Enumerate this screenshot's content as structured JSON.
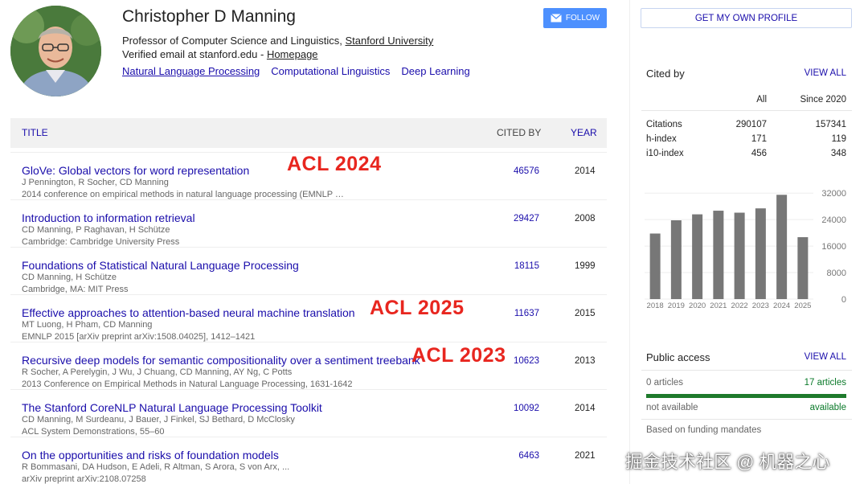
{
  "profile": {
    "name": "Christopher D Manning",
    "affiliation_prefix": "Professor of Computer Science and Linguistics, ",
    "affiliation_link": "Stanford University",
    "email_prefix": "Verified email at stanford.edu - ",
    "homepage_link": "Homepage",
    "interests": [
      "Natural Language Processing",
      "Computational Linguistics",
      "Deep Learning"
    ]
  },
  "actions": {
    "follow_label": "FOLLOW",
    "get_profile_label": "GET MY OWN PROFILE"
  },
  "table": {
    "headers": {
      "title": "TITLE",
      "cited_by": "CITED BY",
      "year": "YEAR"
    },
    "rows": [
      {
        "title": "GloVe: Global vectors for word representation",
        "authors": "J Pennington, R Socher, CD Manning",
        "venue": "2014 conference on empirical methods in natural language processing (EMNLP …",
        "cited_by": "46576",
        "year": "2014"
      },
      {
        "title": "Introduction to information retrieval",
        "authors": "CD Manning, P Raghavan, H Schütze",
        "venue": "Cambridge: Cambridge University Press",
        "cited_by": "29427",
        "year": "2008"
      },
      {
        "title": "Foundations of Statistical Natural Language Processing",
        "authors": "CD Manning, H Schütze",
        "venue": "Cambridge, MA: MIT Press",
        "cited_by": "18115",
        "year": "1999"
      },
      {
        "title": "Effective approaches to attention-based neural machine translation",
        "authors": "MT Luong, H Pham, CD Manning",
        "venue": "EMNLP 2015 [arXiv preprint arXiv:1508.04025], 1412–1421",
        "cited_by": "11637",
        "year": "2015"
      },
      {
        "title": "Recursive deep models for semantic compositionality over a sentiment treebank",
        "authors": "R Socher, A Perelygin, J Wu, J Chuang, CD Manning, AY Ng, C Potts",
        "venue": "2013 Conference on Empirical Methods in Natural Language Processing, 1631-1642",
        "cited_by": "10623",
        "year": "2013"
      },
      {
        "title": "The Stanford CoreNLP Natural Language Processing Toolkit",
        "authors": "CD Manning, M Surdeanu, J Bauer, J Finkel, SJ Bethard, D McClosky",
        "venue": "ACL System Demonstrations, 55–60",
        "cited_by": "10092",
        "year": "2014"
      },
      {
        "title": "On the opportunities and risks of foundation models",
        "authors": "R Bommasani, DA Hudson, E Adeli, R Altman, S Arora, S von Arx, ...",
        "venue": "arXiv preprint arXiv:2108.07258",
        "cited_by": "6463",
        "year": "2021"
      }
    ]
  },
  "overlays": [
    "ACL 2024",
    "ACL 2025",
    "ACL 2023"
  ],
  "cited_by": {
    "title": "Cited by",
    "view_all": "VIEW ALL",
    "columns": {
      "all": "All",
      "since": "Since 2020"
    },
    "rows": [
      {
        "label": "Citations",
        "all": "290107",
        "since": "157341"
      },
      {
        "label": "h-index",
        "all": "171",
        "since": "119"
      },
      {
        "label": "i10-index",
        "all": "456",
        "since": "348"
      }
    ]
  },
  "chart_data": {
    "type": "bar",
    "categories": [
      "2018",
      "2019",
      "2020",
      "2021",
      "2022",
      "2023",
      "2024",
      "2025"
    ],
    "values": [
      19800,
      23800,
      25600,
      26700,
      26100,
      27400,
      31500,
      18700
    ],
    "y_ticks": [
      "0",
      "8000",
      "16000",
      "24000",
      "32000"
    ],
    "ylim": [
      0,
      34000
    ],
    "bar_color": "#777777"
  },
  "public_access": {
    "title": "Public access",
    "view_all": "VIEW ALL",
    "zero_articles": "0 articles",
    "available_articles": "17 articles",
    "not_available": "not available",
    "available": "available",
    "funding_note": "Based on funding mandates"
  },
  "watermark": "掘金技术社区 @ 机器之心"
}
